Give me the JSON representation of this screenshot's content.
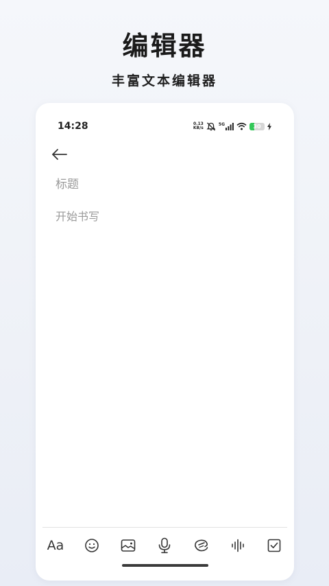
{
  "promo": {
    "title": "编辑器",
    "subtitle": "丰富文本编辑器"
  },
  "status_bar": {
    "time": "14:28",
    "net_speed_value": "0.13",
    "net_speed_unit": "KB/s",
    "network_type": "5G",
    "battery_level": "30",
    "battery_fraction": 0.3,
    "battery_color": "#34c759",
    "icons": [
      "mute-bell-icon",
      "signal-icon",
      "wifi-icon",
      "battery-icon",
      "charging-icon"
    ]
  },
  "editor": {
    "back_icon": "back-arrow-icon",
    "title_placeholder": "标题",
    "body_placeholder": "开始书写"
  },
  "toolbar": {
    "font_label": "Aa",
    "items": [
      "font-style-icon",
      "emoji-icon",
      "image-icon",
      "microphone-icon",
      "sketch-icon",
      "audio-wave-icon",
      "checkbox-icon"
    ]
  }
}
